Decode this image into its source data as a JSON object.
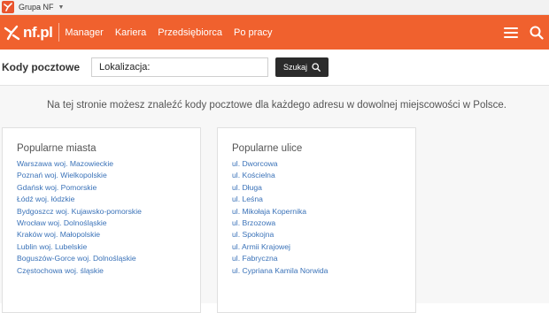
{
  "groupbar": {
    "label": "Grupa NF"
  },
  "brand": {
    "name": "nf.pl"
  },
  "nav": {
    "links": [
      "Manager",
      "Kariera",
      "Przedsiębiorca",
      "Po pracy"
    ]
  },
  "search": {
    "title": "Kody pocztowe",
    "location_label": "Lokalizacja:",
    "location_value": "",
    "button_label": "Szukaj"
  },
  "intro": "Na tej stronie możesz znaleźć kody pocztowe dla każdego adresu w dowolnej miejscowości w Polsce.",
  "cities": {
    "heading": "Popularne miasta",
    "items": [
      "Warszawa woj. Mazowieckie",
      "Poznań woj. Wielkopolskie",
      "Gdańsk woj. Pomorskie",
      "Łódź woj. łódzkie",
      "Bydgoszcz woj. Kujawsko-pomorskie",
      "Wrocław woj. Dolnośląskie",
      "Kraków woj. Małopolskie",
      "Lublin woj. Lubelskie",
      "Boguszów-Gorce woj. Dolnośląskie",
      "Częstochowa woj. śląskie"
    ]
  },
  "streets": {
    "heading": "Popularne ulice",
    "items": [
      "ul. Dworcowa",
      "ul. Kościelna",
      "ul. Długa",
      "ul. Leśna",
      "ul. Mikołaja Kopernika",
      "ul. Brzozowa",
      "ul. Spokojna",
      "ul. Armii Krajowej",
      "ul. Fabryczna",
      "ul. Cypriana Kamila Norwida"
    ]
  },
  "colors": {
    "brand_orange": "#f0612e",
    "link_blue": "#3a72b8",
    "button_dark": "#2b2b2b"
  },
  "icons": [
    "nf-logo-icon",
    "hamburger-menu-icon",
    "search-icon",
    "chevron-down-icon"
  ]
}
